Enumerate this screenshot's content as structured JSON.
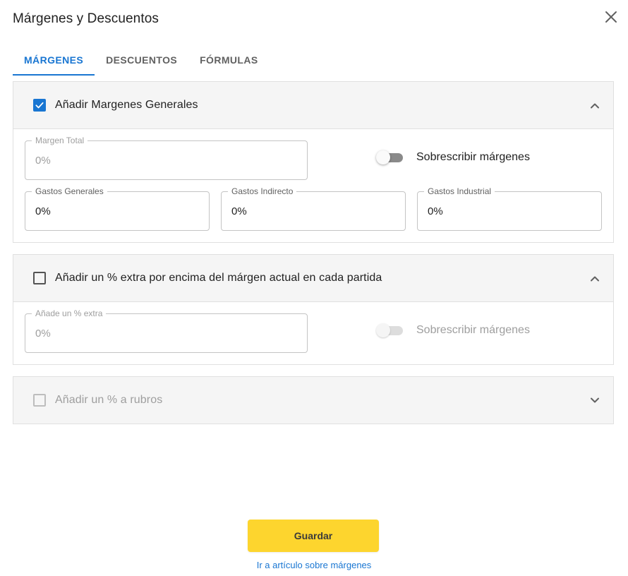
{
  "dialog": {
    "title": "Márgenes y Descuentos"
  },
  "tabs": [
    {
      "label": "MÁRGENES",
      "active": true
    },
    {
      "label": "DESCUENTOS",
      "active": false
    },
    {
      "label": "FÓRMULAS",
      "active": false
    }
  ],
  "section1": {
    "label": "Añadir Margenes Generales",
    "checked": true,
    "expanded": true,
    "margen_total": {
      "label": "Margen Total",
      "value": "0%"
    },
    "toggle_label": "Sobrescribir márgenes",
    "toggle_on": false,
    "gastos_generales": {
      "label": "Gastos Generales",
      "value": "0%"
    },
    "gastos_indirecto": {
      "label": "Gastos Indirecto",
      "value": "0%"
    },
    "gastos_industrial": {
      "label": "Gastos Industrial",
      "value": "0%"
    }
  },
  "section2": {
    "label": "Añadir un % extra por encima del márgen actual en cada partida",
    "checked": false,
    "expanded": true,
    "extra": {
      "label": "Añade un % extra",
      "value": "0%"
    },
    "toggle_label": "Sobrescribir márgenes",
    "toggle_on": false
  },
  "section3": {
    "label": "Añadir un % a rubros",
    "checked": false,
    "disabled": true,
    "expanded": false
  },
  "actions": {
    "save_label": "Guardar",
    "help_link": "Ir a artículo sobre márgenes"
  },
  "colors": {
    "primary": "#1976d2",
    "save_button": "#fdd52e",
    "section_header_bg": "#f5f5f5"
  },
  "icons": {
    "close": "close-icon",
    "checkbox_checked": "check-icon",
    "collapse": "chevron-up-icon",
    "expand": "chevron-down-icon"
  }
}
